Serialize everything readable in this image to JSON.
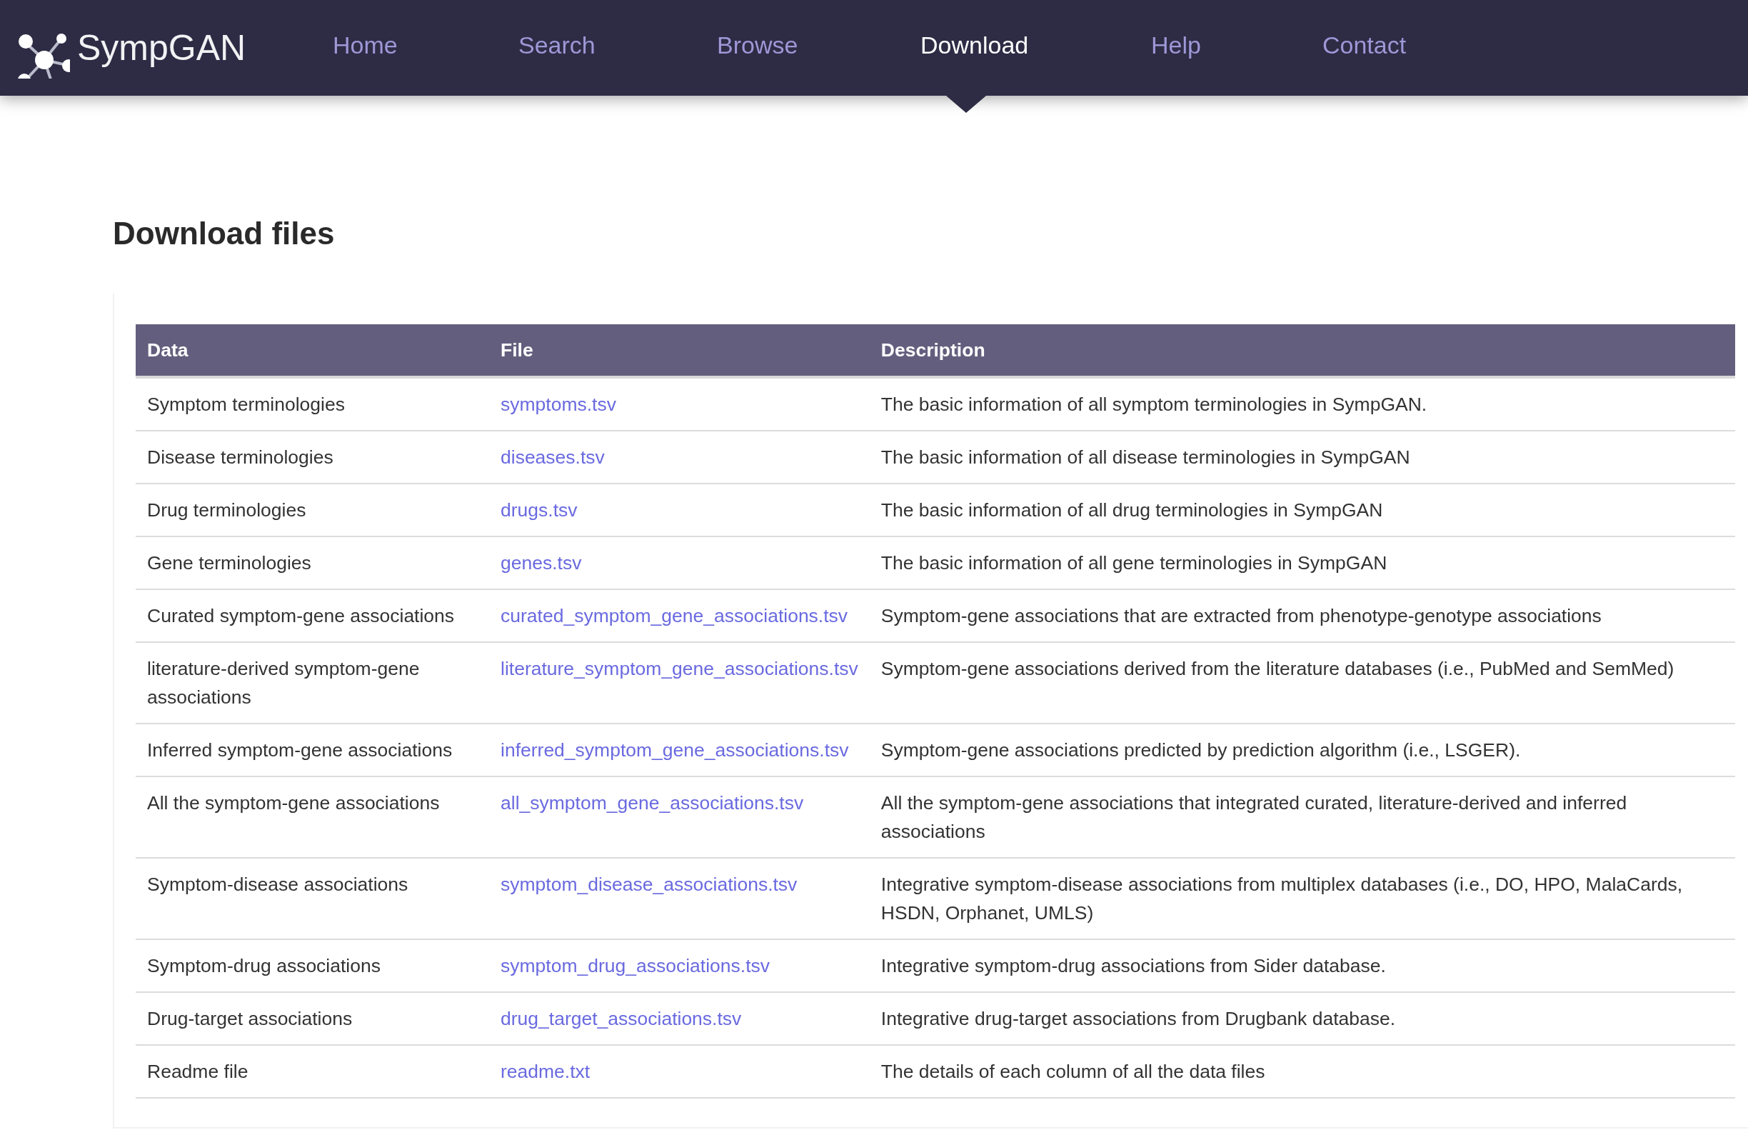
{
  "brand": {
    "name": "SympGAN"
  },
  "nav": [
    {
      "label": "Home",
      "selected": false
    },
    {
      "label": "Search",
      "selected": false
    },
    {
      "label": "Browse",
      "selected": false
    },
    {
      "label": "Download",
      "selected": true
    },
    {
      "label": "Help",
      "selected": false
    },
    {
      "label": "Contact",
      "selected": false
    }
  ],
  "page_title": "Download files",
  "table": {
    "columns": [
      "Data",
      "File",
      "Description"
    ],
    "rows": [
      {
        "data": "Symptom terminologies",
        "file": "symptoms.tsv",
        "description": "The basic information of all symptom terminologies in SympGAN."
      },
      {
        "data": "Disease terminologies",
        "file": "diseases.tsv",
        "description": "The basic information of all disease terminologies in SympGAN"
      },
      {
        "data": "Drug terminologies",
        "file": "drugs.tsv",
        "description": "The basic information of all drug terminologies in SympGAN"
      },
      {
        "data": "Gene terminologies",
        "file": "genes.tsv",
        "description": "The basic information of all gene terminologies in SympGAN"
      },
      {
        "data": "Curated symptom-gene associations",
        "file": "curated_symptom_gene_associations.tsv",
        "description": "Symptom-gene associations that are extracted from phenotype-genotype associations"
      },
      {
        "data": "literature-derived symptom-gene associations",
        "file": "literature_symptom_gene_associations.tsv",
        "description": "Symptom-gene associations derived from the literature databases (i.e., PubMed and SemMed)"
      },
      {
        "data": "Inferred symptom-gene associations",
        "file": "inferred_symptom_gene_associations.tsv",
        "description": "Symptom-gene associations predicted by prediction algorithm (i.e., LSGER)."
      },
      {
        "data": "All the symptom-gene associations",
        "file": "all_symptom_gene_associations.tsv",
        "description": "All the symptom-gene associations that integrated curated, literature-derived and inferred associations"
      },
      {
        "data": "Symptom-disease associations",
        "file": "symptom_disease_associations.tsv",
        "description": "Integrative symptom-disease associations from multiplex databases (i.e., DO, HPO, MalaCards, HSDN, Orphanet, UMLS)"
      },
      {
        "data": "Symptom-drug associations",
        "file": "symptom_drug_associations.tsv",
        "description": "Integrative symptom-drug associations from Sider database."
      },
      {
        "data": "Drug-target associations",
        "file": "drug_target_associations.tsv",
        "description": "Integrative drug-target associations from Drugbank database."
      },
      {
        "data": "Readme file",
        "file": "readme.txt",
        "description": "The details of each column of all the data files"
      }
    ]
  }
}
